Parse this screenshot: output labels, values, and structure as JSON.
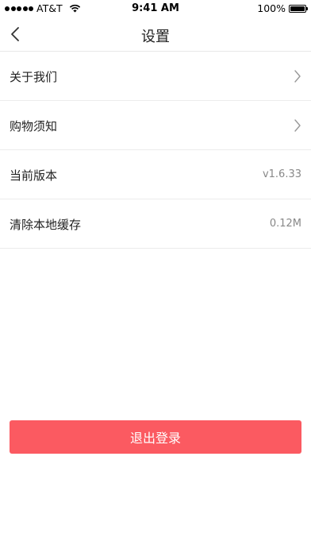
{
  "status_bar": {
    "carrier": "AT&T",
    "time": "9:41 AM",
    "battery_text": "100%"
  },
  "nav": {
    "title": "设置",
    "back_icon": "chevron-left-icon"
  },
  "settings": {
    "items": [
      {
        "label": "关于我们",
        "value": "",
        "icon": "chevron-right-icon"
      },
      {
        "label": "购物须知",
        "value": "",
        "icon": "chevron-right-icon"
      },
      {
        "label": "当前版本",
        "value": "v1.6.33"
      },
      {
        "label": "清除本地缓存",
        "value": "0.12M"
      }
    ]
  },
  "logout": {
    "label": "退出登录"
  },
  "colors": {
    "accent": "#fb5a61",
    "divider": "#ececec",
    "value_text": "#888888"
  }
}
